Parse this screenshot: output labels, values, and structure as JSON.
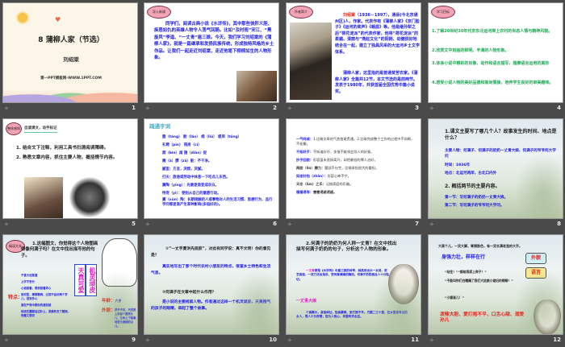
{
  "footer_icon": "slide-transition-icon",
  "slides": [
    {
      "number": "1",
      "title": "8 蒲柳人家（节选）",
      "author": "刘绍棠",
      "source": "第一PPT模板网-WWW.1PPT.COM"
    },
    {
      "number": "2",
      "badge": "导入新课",
      "text": "同学们，阅读古典小说《水浒传》，其中那些侠肝义胆、疾恶如仇的英雄人物令人荡气回肠。比如“及时雨”宋江、“黑旋风”李逵、“一丈青”扈三娘。今天，我们学习刘绍棠的《蒲柳人家》，就是一篇继承和发扬民族传统，形成独特风格的乡土作品。让我们一起走近刘绍棠，走近他笔下栩栩如生的人物形象。"
    },
    {
      "number": "3",
      "badge": "作者简介",
      "name": "刘绍棠",
      "bio": "（1936－1997），通县(今北京通州区)人，作家。代表作有《蒲柳人家》《京门脸子》《运河的桨声》《蛾眉》等。他是继孙犁之后“荷花淀派”的代表作家，他将“荷花淀派”的柔媚、清丽与“燕赵文化”的阳刚、劲健很好地结合在一起，建立了独具风采的大运河乡土文学体系。",
      "note": "蒲柳人家，这里指的是普通贫苦农家。《蒲柳人家》全篇共12节，本文节选的是前两节。发表于1980年，并获首届全国优秀中篇小说奖。"
    },
    {
      "number": "4",
      "badge": "学习目标",
      "goals": [
        "1.了解20世纪30年代京东北运河岸上农村的世态人情与精神风貌。",
        "2.欣赏文中刻画的鲜明、丰满的人物形象。",
        "3.体会小说中精彩的肖像、动作和语言描写，揣摩语言运用的高妙",
        "4.感受小说人物的美好品德和高尚情操，培养学生良好的审美趣味。"
      ]
    },
    {
      "number": "5",
      "badge": "整体感知",
      "subtitle": "自读课文，动手标记",
      "tasks": [
        "1. 结合文下注释，利用工具书扫清阅读障碍。",
        "2. 熟悉文章内容，抓住主要人物，概括情节内容。"
      ]
    },
    {
      "number": "6",
      "title": "疏通字词",
      "lines": [
        "膛（táng）  舱（lǎo）  绺（liǔ）  堤岸（tóng）",
        "礼聘（pìn）    陪房（cì）",
        "禁（bìn）闺    翅（diān）捉",
        "腌（ā）臜（zā）脏：不干净。",
        "腻歪：方言，厌烦，厌腻。",
        "打尖：旅途或劳动中休息一下吃点儿东西。",
        "熏陶（yīng）：光景逐渐变成灰白。",
        "恃宠（yì）：使别从自己的意愿行动。",
        "熏（xūn）陶：长期接触的人或事物对人的生活习惯、思想行为、品行学问等逐渐产生某种影响(多指好的)。"
      ]
    },
    {
      "number": "7",
      "lines": [
        [
          "一气呵成：",
          "1.比喻文章的气势首尾贯通。2.比喻完成整个工作的过程中不间断，不松懈。"
        ],
        [
          "不知好歹：",
          "不知道好坏，多指不能领会别人的好意。"
        ],
        [
          "抄手回脸：",
          "形容虽未直接离开，却把最低的罪人治好。"
        ],
        [
          "两脸（lìn）膊力：",
          "腰部不仕完，比喻承担很大的重担。"
        ],
        [
          "如坐针毡（zhān）：",
          "形容心神不宁。"
        ],
        [
          "天伦（lún）之乐：",
          "泛指家庭的乐趣。"
        ],
        [
          "循循诱导：",
          "善善诱惑诱惑。"
        ]
      ]
    },
    {
      "number": "8",
      "q1": "1.课文主要写了哪几个人？故事发生的时间、地点是什么？",
      "a1": [
        "主要人物：何满子、何满子的奶奶一丈青大娘、何满子的爷爷何大学问",
        "时间：1936年",
        "地点：北运河两岸，古北口内外"
      ],
      "q2": "2. 概括两节的主要内容。",
      "a2": [
        "第一节：写何满子的奶奶一丈青大娘。",
        "第二节：写何满子的爷爷何大学问。"
      ]
    },
    {
      "number": "9",
      "badge": "精读文本",
      "question": "1.这幅图文，你觉得这个人物图画得像何满子吗？在文中找出描写他的句子。",
      "box1": "天真可爱",
      "box2": "机灵顽皮",
      "trait_label": "特点：",
      "traits": [
        "不曾大如莲蓬",
        "上学不安分",
        "心裕惦着，想到惦着弄心",
        "到河里，撵群鹅鸭，过耳不会好两个字儿，捏到手心",
        "落在严母中跟你的道别就",
        "他找在腰腿后边扑上，发痛有去了腿侧，觉着又想河"
      ],
      "age_label": "年龄：",
      "age": "六岁",
      "look_label": "外貌：",
      "look": "胖乎乎的，天然是上面留个圆壳头儿，生命上下就像地里头细细的瓜儿。"
    },
    {
      "number": "10",
      "q1": "①“一丈字夏洪先底胶”，对此有同学说：真不文明！你的意见是？",
      "a1": "真实地写出了那个时代农村小朋友的特点，很富乡土特色和生活气息。",
      "q2": "②何满子在文章中起什么作用？",
      "a2": "是小说的主要线索人物。作者通过这样一个机灵顽皮、天真稚气的孩子的眼睛，串起了整个故事。"
    },
    {
      "number": "11",
      "q": "2.何满子的奶奶为何人称一丈青？在文中找出描写何满子奶奶的句子，分析这个人物的形象。",
      "a1_name": "一丈青",
      "a1": "原是《水浒传》中扈三娘的绰号，她英武出众一女将，武艺高强，一双刀法出鬼没，更有兼满嫡的胸技。何满子奶奶借此人十分贴切。",
      "head": "一丈青大娘",
      "a2": "个高脚大，身强体壮，性格豪爽，爱打抱不平。方圆二三十里，在乡里是有名的女人，骂人十分厉害，但为人热心，邻里有求必应。"
    },
    {
      "number": "12",
      "top": "大高个儿，一双大脚，青铜肤色，有一双长满老茧的大手。",
      "trait": "身强力壮，样样在行",
      "quotes": [
        "“站住！”“都给我滚上岸子！”",
        "“不能叫你们白糟蹋了我们大姑娘小媳妇的眼睛！”",
        "“小猴崽儿！”"
      ],
      "box1": "外貌",
      "box2": "语言",
      "summary": "泼辣大胆、爱打抱不平、口舌心甜、溺爱孙儿"
    }
  ]
}
